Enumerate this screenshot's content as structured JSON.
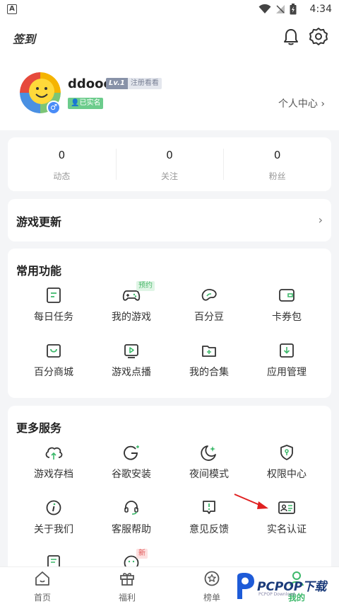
{
  "statusbar": {
    "time": "4:34",
    "left_icon": "A"
  },
  "topbar": {
    "signin_label": "签到"
  },
  "profile": {
    "username": "ddooo",
    "level": "Lv.1",
    "registered_label": "注册看看",
    "verified_label": "已实名",
    "gender_symbol": "♂",
    "center_link": "个人中心 ›"
  },
  "stats": [
    {
      "value": "0",
      "label": "动态"
    },
    {
      "value": "0",
      "label": "关注"
    },
    {
      "value": "0",
      "label": "粉丝"
    }
  ],
  "updates": {
    "title": "游戏更新",
    "chevron": "›"
  },
  "common": {
    "title": "常用功能",
    "items": [
      {
        "label": "每日任务",
        "icon": "task-icon"
      },
      {
        "label": "我的游戏",
        "icon": "gamepad-icon",
        "tag": "预约"
      },
      {
        "label": "百分豆",
        "icon": "bean-icon"
      },
      {
        "label": "卡券包",
        "icon": "wallet-icon"
      },
      {
        "label": "百分商城",
        "icon": "shop-icon"
      },
      {
        "label": "游戏点播",
        "icon": "play-icon"
      },
      {
        "label": "我的合集",
        "icon": "folder-add-icon"
      },
      {
        "label": "应用管理",
        "icon": "download-box-icon"
      }
    ]
  },
  "more": {
    "title": "更多服务",
    "items": [
      {
        "label": "游戏存档",
        "icon": "cloud-upload-icon"
      },
      {
        "label": "谷歌安装",
        "icon": "google-icon"
      },
      {
        "label": "夜间模式",
        "icon": "moon-icon"
      },
      {
        "label": "权限中心",
        "icon": "shield-icon"
      },
      {
        "label": "关于我们",
        "icon": "info-icon"
      },
      {
        "label": "客服帮助",
        "icon": "headset-icon"
      },
      {
        "label": "意见反馈",
        "icon": "feedback-icon"
      },
      {
        "label": "实名认证",
        "icon": "id-card-icon"
      },
      {
        "label": "",
        "icon": "document-icon"
      },
      {
        "label": "",
        "icon": "face-icon",
        "tag": "新"
      }
    ]
  },
  "bottomnav": {
    "items": [
      {
        "label": "首页",
        "icon": "home-icon"
      },
      {
        "label": "福利",
        "icon": "gift-icon"
      },
      {
        "label": "榜单",
        "icon": "star-badge-icon"
      },
      {
        "label": "我的",
        "icon": "user-icon",
        "active": true
      }
    ]
  },
  "watermark": {
    "text": "PCPOP下载",
    "sub": "PCPOP Download"
  },
  "colors": {
    "accent": "#3cb86a",
    "verified": "#6ccc8c",
    "level": "#8892a8",
    "arrow": "#e02020"
  }
}
